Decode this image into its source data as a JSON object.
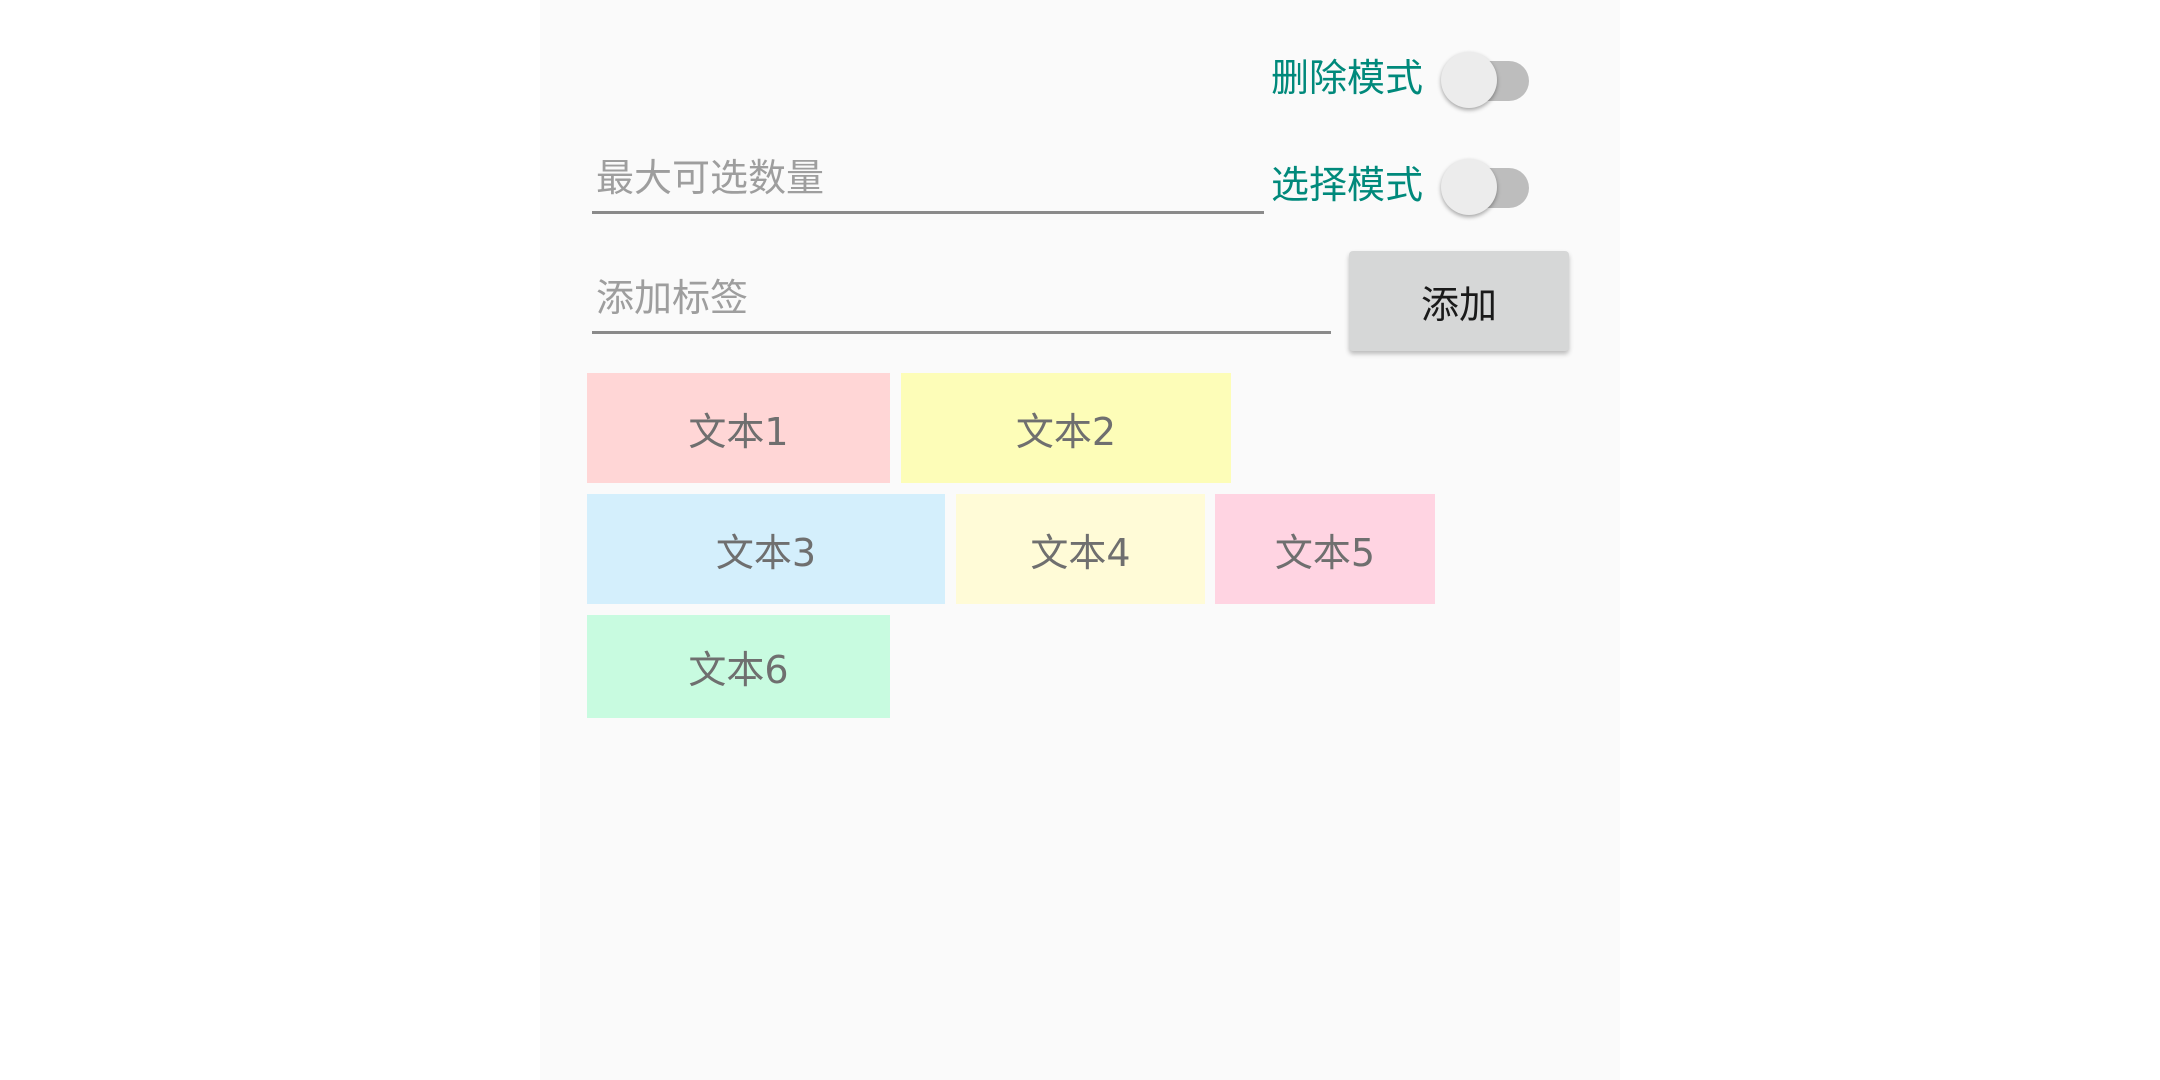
{
  "delete_mode": {
    "label": "删除模式",
    "enabled": false
  },
  "select_mode": {
    "label": "选择模式",
    "enabled": false
  },
  "max_select_input": {
    "placeholder": "最大可选数量",
    "value": ""
  },
  "add_tag_input": {
    "placeholder": "添加标签",
    "value": ""
  },
  "add_button": {
    "label": "添加"
  },
  "tags": [
    {
      "label": "文本1",
      "color": "#ffd6d6"
    },
    {
      "label": "文本2",
      "color": "#fdfdb8"
    },
    {
      "label": "文本3",
      "color": "#d4effc"
    },
    {
      "label": "文本4",
      "color": "#fffbd7"
    },
    {
      "label": "文本5",
      "color": "#ffd4e2"
    },
    {
      "label": "文本6",
      "color": "#c8fbe0"
    }
  ],
  "colors": {
    "accent": "#00897b",
    "screen_background": "#fafafa"
  }
}
